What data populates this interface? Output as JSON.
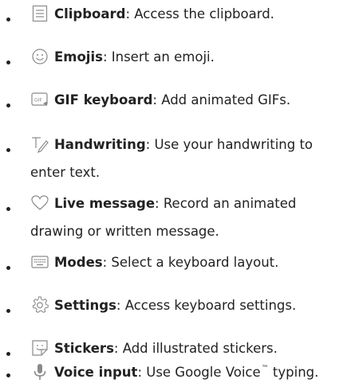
{
  "items": [
    {
      "icon": "clipboard-icon",
      "term": "Clipboard",
      "desc": ": Access the clipboard."
    },
    {
      "icon": "emoji-icon",
      "term": "Emojis",
      "desc": ": Insert an emoji."
    },
    {
      "icon": "gif-keyboard-icon",
      "term": "GIF keyboard",
      "desc": ": Add animated GIFs."
    },
    {
      "icon": "handwriting-icon",
      "term": "Handwriting",
      "desc": ": Use your handwriting to",
      "desc2": "enter text."
    },
    {
      "icon": "live-message-icon",
      "term": "Live message",
      "desc": ": Record an animated",
      "desc2": "drawing or written message."
    },
    {
      "icon": "keyboard-modes-icon",
      "term": "Modes",
      "desc": ": Select a keyboard layout."
    },
    {
      "icon": "settings-gear-icon",
      "term": "Settings",
      "desc": ": Access keyboard settings."
    },
    {
      "icon": "sticker-icon",
      "term": "Stickers",
      "desc": ": Add illustrated stickers."
    },
    {
      "icon": "microphone-icon",
      "term": "Voice input",
      "desc": ": Use Google Voice",
      "tm": "™",
      "desc_after_tm": " typing."
    }
  ],
  "colors": {
    "text": "#222222",
    "icon_gray": "#8a8a8a"
  }
}
